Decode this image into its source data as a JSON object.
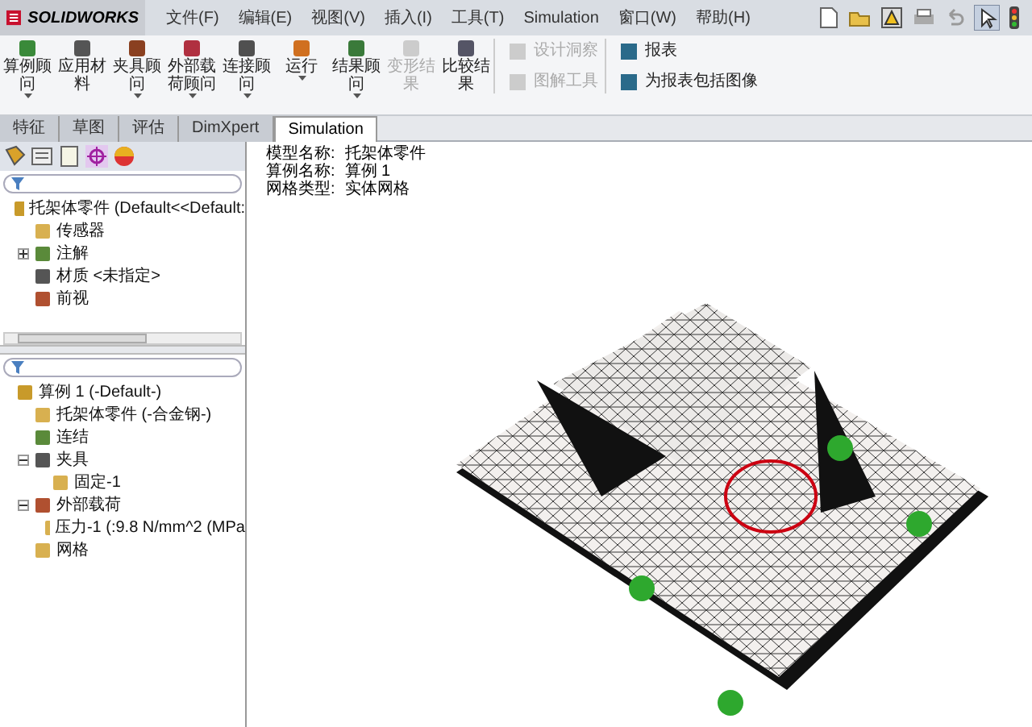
{
  "app": {
    "name": "SOLIDWORKS"
  },
  "menu": [
    {
      "label": "文件(F)"
    },
    {
      "label": "编辑(E)"
    },
    {
      "label": "视图(V)"
    },
    {
      "label": "插入(I)"
    },
    {
      "label": "工具(T)"
    },
    {
      "label": "Simulation"
    },
    {
      "label": "窗口(W)"
    },
    {
      "label": "帮助(H)"
    }
  ],
  "ribbon": [
    {
      "kind": "large",
      "label": "算例顾问",
      "disabled": false,
      "dropdown": true
    },
    {
      "kind": "large",
      "label": "应用材料",
      "disabled": false,
      "dropdown": false
    },
    {
      "kind": "large",
      "label": "夹具顾问",
      "disabled": false,
      "dropdown": true
    },
    {
      "kind": "large",
      "label": "外部载荷顾问",
      "disabled": false,
      "dropdown": true
    },
    {
      "kind": "large",
      "label": "连接顾问",
      "disabled": false,
      "dropdown": true
    },
    {
      "kind": "large",
      "label": "运行",
      "disabled": false,
      "dropdown": true
    },
    {
      "kind": "large",
      "label": "结果顾问",
      "disabled": false,
      "dropdown": true
    },
    {
      "kind": "large",
      "label": "变形结果",
      "disabled": true,
      "dropdown": false
    },
    {
      "kind": "large",
      "label": "比较结果",
      "disabled": false,
      "dropdown": false
    },
    {
      "kind": "small",
      "label": "设计洞察",
      "disabled": true
    },
    {
      "kind": "small",
      "label": "图解工具",
      "disabled": true
    },
    {
      "kind": "small",
      "label": "报表",
      "disabled": false
    },
    {
      "kind": "small",
      "label": "为报表包括图像",
      "disabled": false
    }
  ],
  "tabs": [
    {
      "label": "特征",
      "selected": false
    },
    {
      "label": "草图",
      "selected": false
    },
    {
      "label": "评估",
      "selected": false
    },
    {
      "label": "DimXpert",
      "selected": false
    },
    {
      "label": "Simulation",
      "selected": true
    }
  ],
  "feature_tree": [
    {
      "label": "托架体零件  (Default<<Default:",
      "children": [
        {
          "label": "传感器"
        },
        {
          "label": "注解",
          "expanded": false
        },
        {
          "label": "材质 <未指定>"
        },
        {
          "label": "前视"
        }
      ]
    }
  ],
  "study_tree": [
    {
      "label": "算例 1 (-Default-)",
      "children": [
        {
          "label": "托架体零件 (-合金钢-)"
        },
        {
          "label": "连结"
        },
        {
          "label": "夹具",
          "expanded": true,
          "children": [
            {
              "label": "固定-1"
            }
          ]
        },
        {
          "label": "外部载荷",
          "expanded": true,
          "children": [
            {
              "label": "压力-1 (:9.8 N/mm^2 (MPa"
            }
          ]
        },
        {
          "label": "网格"
        }
      ]
    }
  ],
  "viewport": {
    "info": [
      {
        "label": "模型名称:",
        "value": "托架体零件"
      },
      {
        "label": "算例名称:",
        "value": "算例 1"
      },
      {
        "label": "网格类型:",
        "value": "实体网格"
      }
    ]
  }
}
